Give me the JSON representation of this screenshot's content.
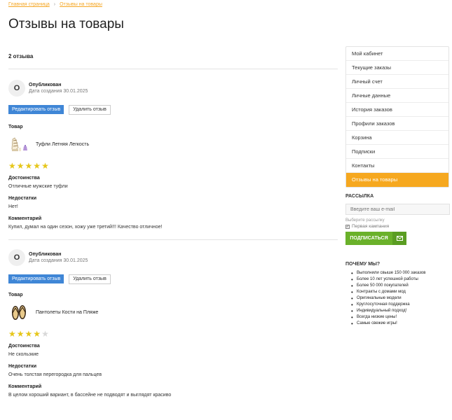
{
  "breadcrumb": {
    "home": "Главная страница",
    "separator": "›",
    "current": "Отзывы на товары"
  },
  "page_title": "Отзывы на товары",
  "reviews_count": "2 отзыва",
  "reviews": [
    {
      "avatar_letter": "О",
      "author": "Опубликован",
      "date": "Дата создания 30.01.2025",
      "edit_label": "Редактировать отзыв",
      "delete_label": "Удалить отзыв",
      "product_label": "Товар",
      "product_name": "Туфли Летняя Легкость",
      "rating": 5,
      "pros_label": "Достоинства",
      "pros": "Отличные мужские туфли",
      "cons_label": "Недостатки",
      "cons": "Нет!",
      "comment_label": "Комментарий",
      "comment": "Купил, думал на один сезон, хожу уже третий!!! Качество отличное!"
    },
    {
      "avatar_letter": "О",
      "author": "Опубликован",
      "date": "Дата создания 30.01.2025",
      "edit_label": "Редактировать отзыв",
      "delete_label": "Удалить отзыв",
      "product_label": "Товар",
      "product_name": "Пантолеты Кости на Пляже",
      "rating": 4,
      "pros_label": "Достоинства",
      "pros": "Не скользкие",
      "cons_label": "Недостатки",
      "cons": "Очень толстая перегородка для пальцев",
      "comment_label": "Комментарий",
      "comment": "В целом хороший вариант, в бассейне не подводят и выглядят красиво"
    }
  ],
  "sidebar": {
    "menu": [
      "Мой кабинет",
      "Текущие заказы",
      "Личный счет",
      "Личные данные",
      "История заказов",
      "Профили заказов",
      "Корзина",
      "Подписки",
      "Контакты",
      "Отзывы на товары"
    ],
    "active_index": 9,
    "subscribe_title": "РАССЫЛКА",
    "email_placeholder": "Введите ваш e-mail",
    "select_hint": "Выберите рассылку",
    "checkbox_label": "Первая кампания",
    "subscribe_button": "ПОДПИСАТЬСЯ",
    "why_title": "ПОЧЕМУ МЫ?",
    "why_items": [
      "Выполнили свыше 150 000 заказов",
      "Более 10 лет успешной работы",
      "Более 50 000 покупателей",
      "Контракты с домами мод",
      "Оригинальные модели",
      "Круглосуточная поддержка",
      "Индивидуальный подход!",
      "Всегда низкие цены!",
      "Самые свежие игры!"
    ]
  },
  "colors": {
    "accent": "#f6a81f",
    "link": "#f5a623",
    "edit_button": "#3f86d6",
    "subscribe": "#6ab12a",
    "star_on": "#e6c619",
    "star_off": "#d8d8d8"
  }
}
